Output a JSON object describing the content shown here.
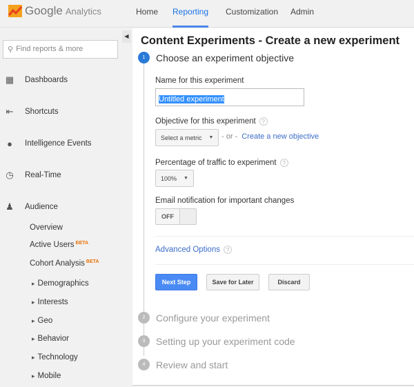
{
  "header": {
    "brand": "Google",
    "product": "Analytics",
    "nav": [
      "Home",
      "Reporting",
      "Customization",
      "Admin"
    ],
    "active_nav": "Reporting"
  },
  "sidebar": {
    "search_placeholder": "Find reports & more",
    "items": [
      "Dashboards",
      "Shortcuts",
      "Intelligence Events",
      "Real-Time",
      "Audience"
    ],
    "audience_sub": [
      {
        "label": "Overview"
      },
      {
        "label": "Active Users",
        "badge": "BETA"
      },
      {
        "label": "Cohort Analysis",
        "badge": "BETA"
      }
    ],
    "audience_groups": [
      "Demographics",
      "Interests",
      "Geo",
      "Behavior",
      "Technology",
      "Mobile"
    ]
  },
  "main": {
    "title": "Content Experiments - Create a new experiment",
    "steps": [
      {
        "n": "1",
        "label": "Choose an experiment objective"
      },
      {
        "n": "2",
        "label": "Configure your experiment"
      },
      {
        "n": "3",
        "label": "Setting up your experiment code"
      },
      {
        "n": "4",
        "label": "Review and start"
      }
    ],
    "name_label": "Name for this experiment",
    "name_value": "Untitled experiment",
    "objective_label": "Objective for this experiment",
    "objective_select": "Select a metric",
    "or": "- or -",
    "create_objective": "Create a new objective",
    "traffic_label": "Percentage of traffic to experiment",
    "traffic_value": "100%",
    "email_label": "Email notification for important changes",
    "email_toggle": "OFF",
    "advanced": "Advanced Options",
    "help": "?",
    "buttons": {
      "next": "Next Step",
      "save": "Save for Later",
      "discard": "Discard"
    }
  },
  "colors": {
    "accent": "#4a8af4",
    "link": "#3b6cc9",
    "beta": "#e8710a"
  }
}
